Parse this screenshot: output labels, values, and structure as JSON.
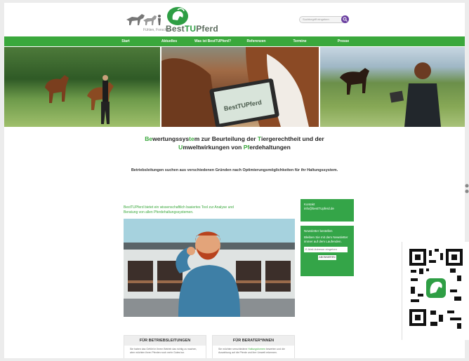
{
  "header": {
    "logo_tag": "Fühlen, Forschen...",
    "logo_text_pre": "Best",
    "logo_text_mid": "TU",
    "logo_text_post": "Pferd",
    "search_placeholder": "Suchbegriff eingeben"
  },
  "nav": {
    "items": [
      "Start",
      "Aktuelles",
      "Was ist BestTUPferd?",
      "Referenzen",
      "Termine",
      "Presse"
    ]
  },
  "hero": {
    "tablet_text": "BestTUPferd"
  },
  "main": {
    "title_part1_g": "Be",
    "title_part1": "wertungssys",
    "title_part2_g": "te",
    "title_part2": "m zur Beurteilung der ",
    "title_part3_g": "T",
    "title_part3": "iergerechtheit und der",
    "title_line2_a": "U",
    "title_line2_b": "mweltwirkungen von ",
    "title_line2_c": "Pf",
    "title_line2_d": "erdehaltungen",
    "subtitle": "Betriebsleitungen suchen aus verschiedenen Gründen nach Optimierungsmöglichkeiten für ihr Haltungssystem.",
    "intro": "BestTUPferd bietet ein wissenschaftlich basiertes Tool zur Analyse und Beratung von allen Pferdehaltungssystemen."
  },
  "sidebar": {
    "box1_line1": "Kontakt",
    "box1_line2": "info@bestTUpferd.de",
    "box2_line1": "Newsletter bestellen",
    "box2_line2": "Bleiben Sie mit dem Newsletter immer auf dem Laufenden.",
    "input_placeholder": "E-Mail-Adresse eingeben",
    "button": "ABONNIEREN"
  },
  "cards": [
    {
      "title": "FÜR BETRIEBSLEITUNGEN",
      "text": "Sie haben das Gefühl in Ihrem Betrieb das richtig zu machen, aber möchten Ihren Pferden noch mehr Gutes tun."
    },
    {
      "title": "FÜR BERATER*INNEN",
      "text_pre": "Sie möchten verschiedene ",
      "text_g": "Haltungsformen",
      "text_post": " bewerten und die Auswirkung auf die Pferde und ihre Umwelt erkennen."
    }
  ],
  "colors": {
    "brand_green": "#3aa83c",
    "search_purple": "#6a3fa0"
  }
}
